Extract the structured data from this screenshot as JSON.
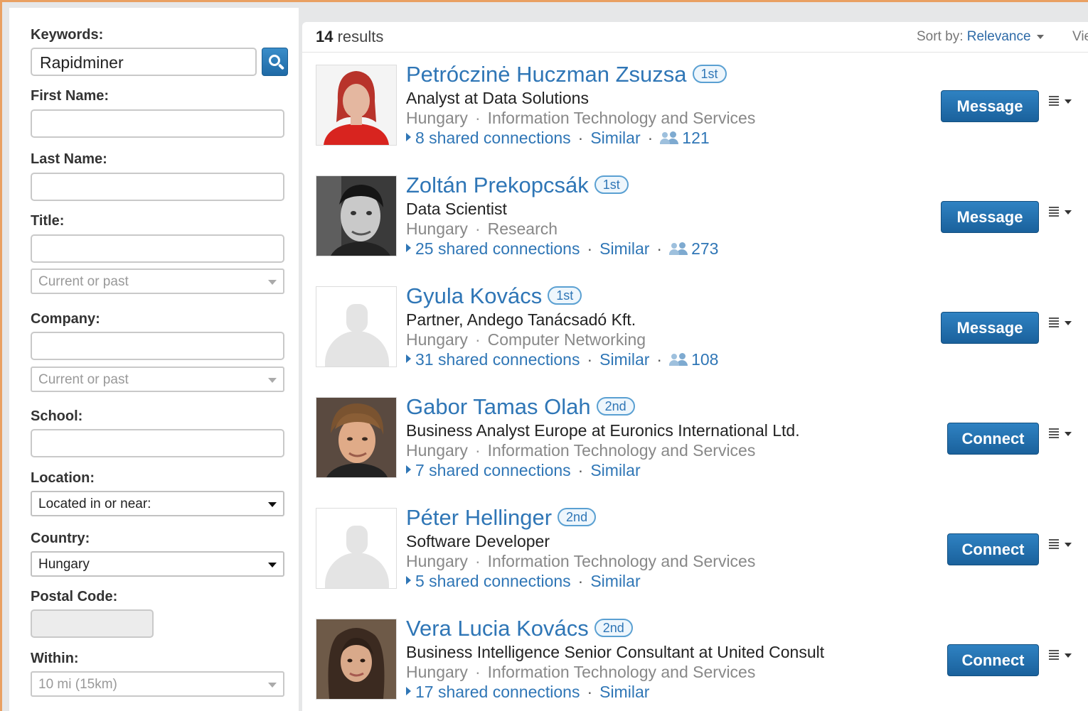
{
  "sidebar": {
    "keywords_label": "Keywords:",
    "keywords_value": "Rapidminer",
    "first_name_label": "First Name:",
    "last_name_label": "Last Name:",
    "title_label": "Title:",
    "title_scope": "Current or past",
    "company_label": "Company:",
    "company_scope": "Current or past",
    "school_label": "School:",
    "location_label": "Location:",
    "location_value": "Located in or near:",
    "country_label": "Country:",
    "country_value": "Hungary",
    "postal_label": "Postal Code:",
    "within_label": "Within:",
    "within_value": "10 mi (15km)"
  },
  "results": {
    "count": "14",
    "count_suffix": " results",
    "sort_label": "Sort by: ",
    "sort_value": "Relevance",
    "view_label": "Vie",
    "items": [
      {
        "name": "Petróczinė Huczman Zsuzsa",
        "degree": "1st",
        "headline": "Analyst at Data Solutions",
        "location": "Hungary",
        "industry": "Information Technology and Services",
        "shared": "8 shared connections",
        "similar": "Similar",
        "connections": "121",
        "action": "Message"
      },
      {
        "name": "Zoltán Prekopcsák",
        "degree": "1st",
        "headline": "Data Scientist",
        "location": "Hungary",
        "industry": "Research",
        "shared": "25 shared connections",
        "similar": "Similar",
        "connections": "273",
        "action": "Message"
      },
      {
        "name": "Gyula Kovács",
        "degree": "1st",
        "headline": "Partner, Andego Tanácsadó Kft.",
        "location": "Hungary",
        "industry": "Computer Networking",
        "shared": "31 shared connections",
        "similar": "Similar",
        "connections": "108",
        "action": "Message"
      },
      {
        "name": "Gabor Tamas Olah",
        "degree": "2nd",
        "headline": "Business Analyst Europe at Euronics International Ltd.",
        "location": "Hungary",
        "industry": "Information Technology and Services",
        "shared": "7 shared connections",
        "similar": "Similar",
        "action": "Connect"
      },
      {
        "name": "Péter Hellinger",
        "degree": "2nd",
        "headline": "Software Developer",
        "location": "Hungary",
        "industry": "Information Technology and Services",
        "shared": "5 shared connections",
        "similar": "Similar",
        "action": "Connect"
      },
      {
        "name": "Vera Lucia Kovács",
        "degree": "2nd",
        "headline": "Business Intelligence Senior Consultant at United Consult",
        "location": "Hungary",
        "industry": "Information Technology and Services",
        "shared": "17 shared connections",
        "similar": "Similar",
        "action": "Connect"
      }
    ]
  },
  "colors": {
    "link": "#2f76b6",
    "button": "#1f6aa6",
    "frame": "#e9a062"
  },
  "icons": [
    "search-icon",
    "people-icon",
    "list-menu-icon",
    "chevron-down-icon",
    "avatar-placeholder-icon"
  ]
}
